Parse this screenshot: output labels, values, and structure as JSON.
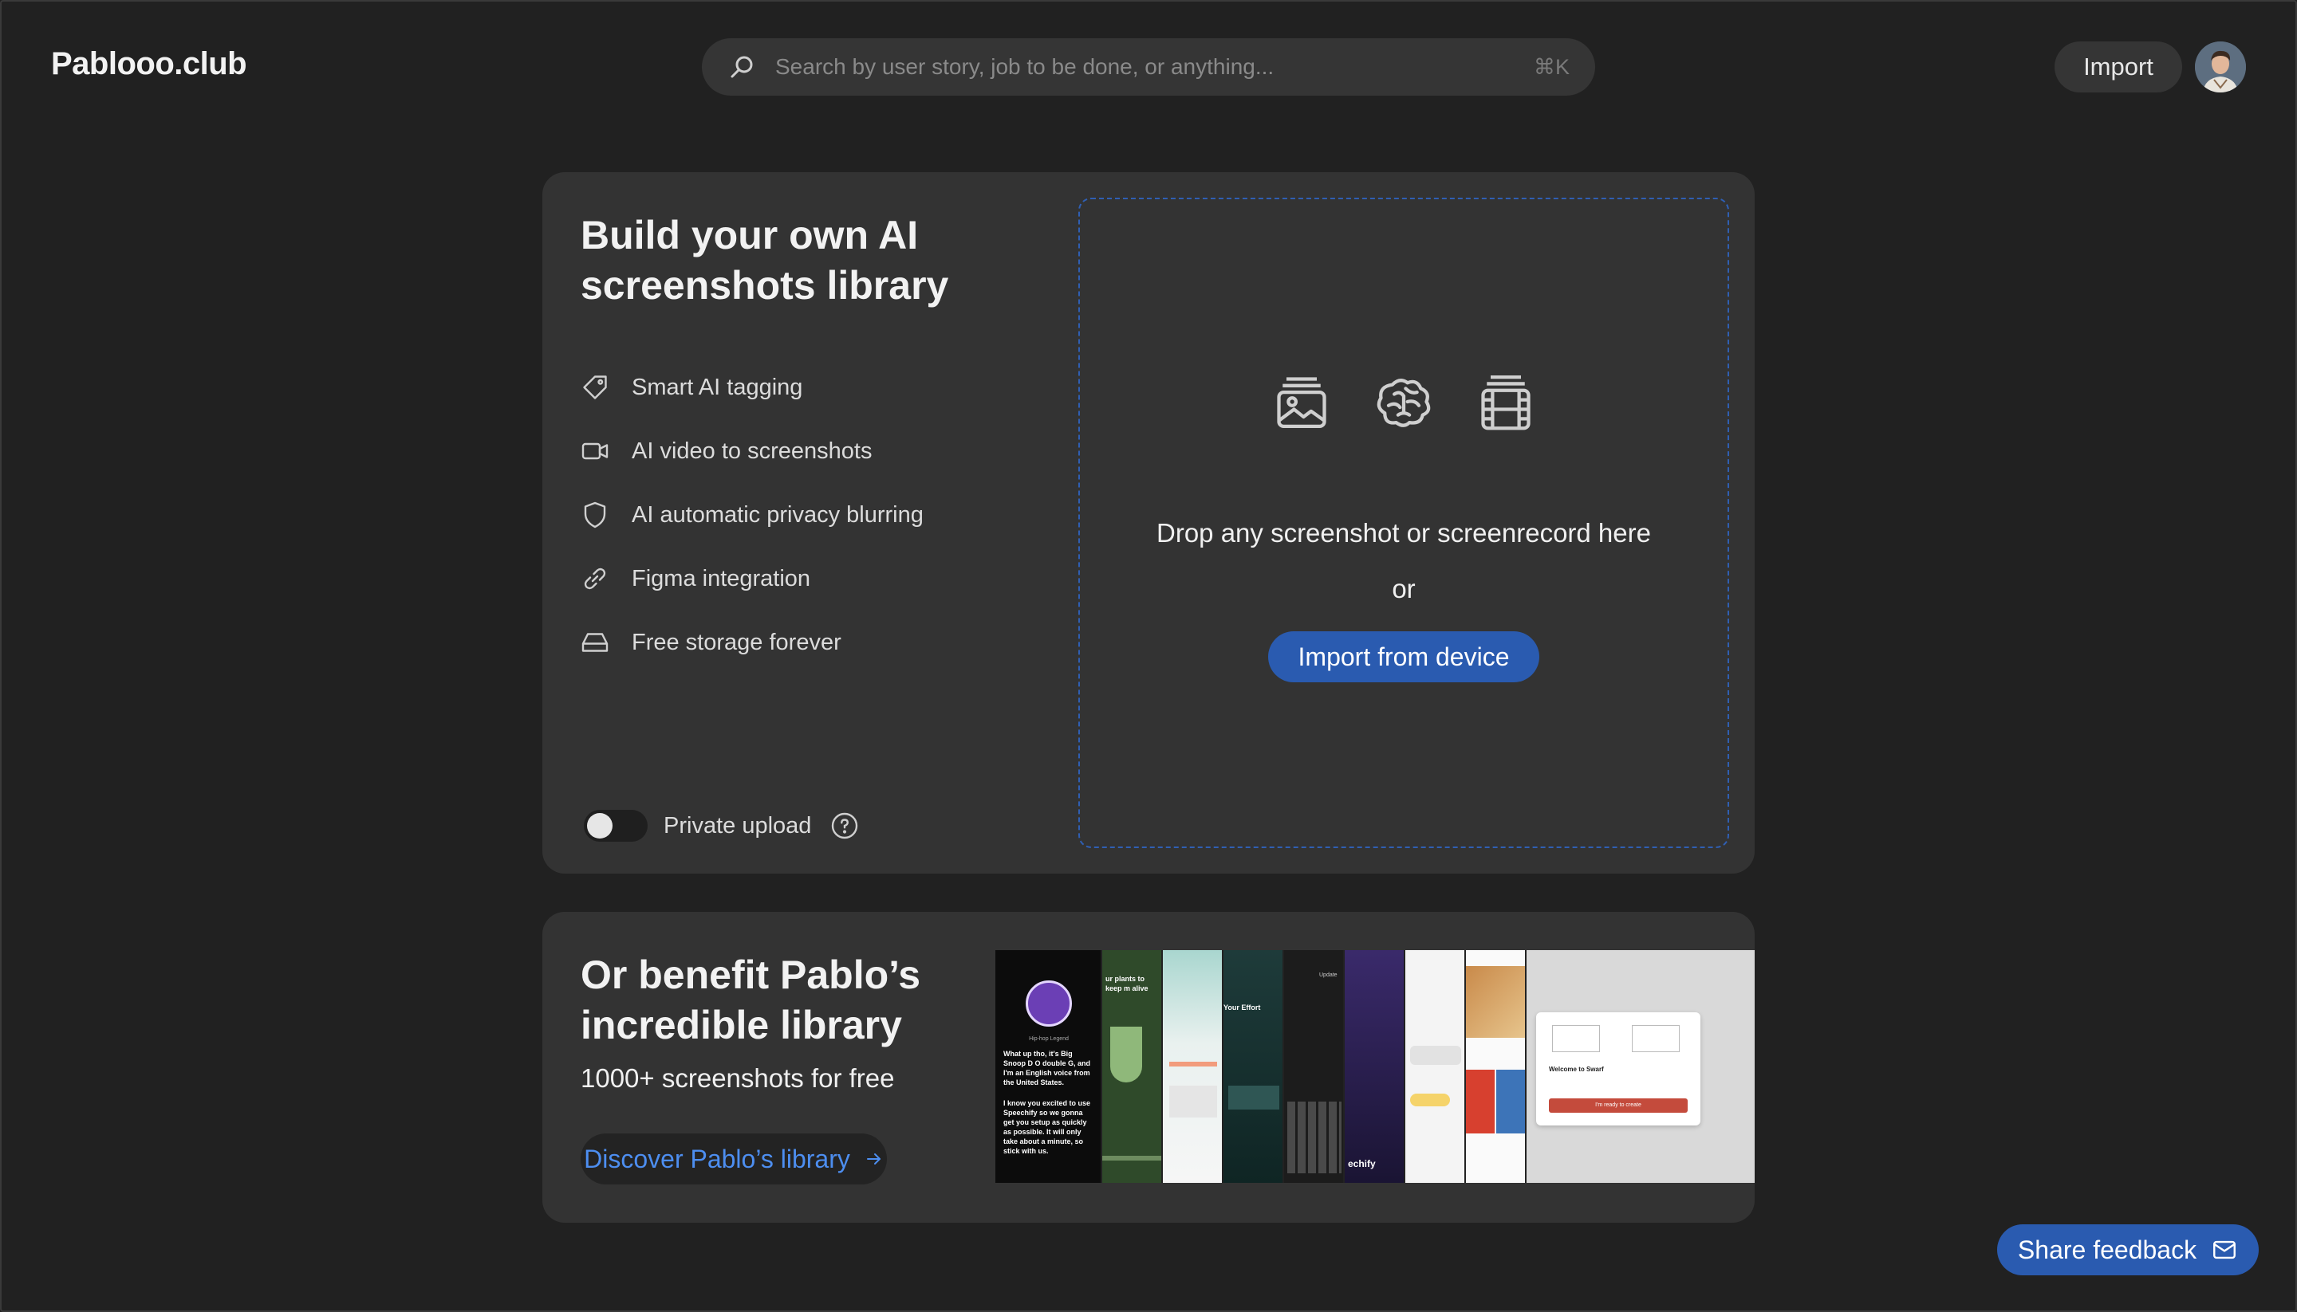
{
  "header": {
    "logo": "Pablooo.club",
    "search_placeholder": "Search by user story, job to be done, or anything...",
    "search_shortcut": "⌘K",
    "import_label": "Import"
  },
  "build": {
    "title": "Build your own AI screenshots library",
    "features": [
      {
        "label": "Smart AI tagging",
        "icon": "tag-icon"
      },
      {
        "label": "AI video to screenshots",
        "icon": "video-camera-icon"
      },
      {
        "label": "AI automatic privacy blurring",
        "icon": "shield-icon"
      },
      {
        "label": "Figma integration",
        "icon": "link-icon"
      },
      {
        "label": "Free storage forever",
        "icon": "storage-drive-icon"
      }
    ],
    "private_upload_label": "Private upload",
    "private_upload_enabled": false,
    "dropzone": {
      "text": "Drop any screenshot or screenrecord here",
      "or": "or",
      "button": "Import from device"
    }
  },
  "library": {
    "title": "Or benefit Pablo’s incredible library",
    "subtitle": "1000+ screenshots for free",
    "button": "Discover Pablo’s library",
    "previews": {
      "s1_name": "Hip-hop Legend",
      "s1_text": "What up tho, it's Big Snoop D O double G, and I'm an English voice from the United States.",
      "s1_text2": "I know you excited to use Speechify so we gonna get you setup as quickly as possible. It will only take about a minute, so stick with us.",
      "s2_text": "ur plants to keep m alive",
      "s4_text": "Your Effort",
      "s5_text": "Update",
      "s7_text": "echify",
      "s10_title": "Welcome to Swarf",
      "s10_btn": "I'm ready to create"
    }
  },
  "feedback_label": "Share feedback",
  "colors": {
    "background": "#212121",
    "card": "#333333",
    "accent": "#2a5bb0",
    "link": "#4d8ef0"
  }
}
